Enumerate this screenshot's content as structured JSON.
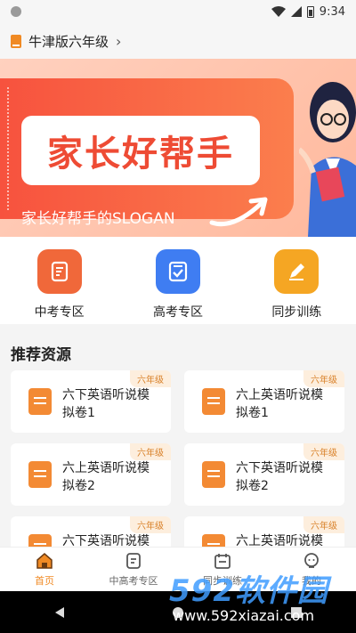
{
  "status_bar": {
    "time": "9:34"
  },
  "header": {
    "grade_title": "牛津版六年级"
  },
  "banner": {
    "title": "家长好帮手",
    "slogan": "家长好帮手的SLOGAN"
  },
  "tiles": [
    {
      "label": "中考专区",
      "icon": "scroll-icon",
      "color": "#f0683a"
    },
    {
      "label": "高考专区",
      "icon": "checklist-icon",
      "color": "#3f7df2"
    },
    {
      "label": "同步训练",
      "icon": "pencil-icon",
      "color": "#f5a623"
    }
  ],
  "recommend": {
    "title": "推荐资源",
    "items": [
      {
        "name": "六下英语听说模拟卷1",
        "badge": "六年级"
      },
      {
        "name": "六上英语听说模拟卷1",
        "badge": "六年级"
      },
      {
        "name": "六上英语听说模拟卷2",
        "badge": "六年级"
      },
      {
        "name": "六下英语听说模拟卷2",
        "badge": "六年级"
      },
      {
        "name": "六下英语听说模",
        "badge": "六年级"
      },
      {
        "name": "六上英语听说模",
        "badge": "六年级"
      }
    ]
  },
  "bottom_nav": [
    {
      "label": "首页",
      "active": true
    },
    {
      "label": "中高考专区",
      "active": false
    },
    {
      "label": "同步训练",
      "active": false
    },
    {
      "label": "我的",
      "active": false
    }
  ],
  "watermark": {
    "brand": "592软件园",
    "url": "www.592xiazai.com"
  },
  "colors": {
    "accent": "#f08a24",
    "banner_red": "#f7523e",
    "page_bg": "#f4f4f4"
  }
}
